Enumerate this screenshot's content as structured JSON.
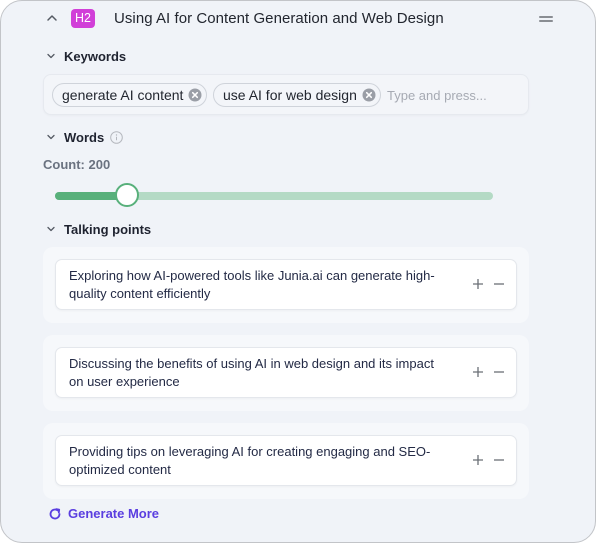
{
  "section": {
    "heading_level": "H2",
    "title": "Using AI for Content Generation and Web Design",
    "collapse_icon": "chevron-up-icon",
    "drag_icon": "drag-handle-icon"
  },
  "keywords": {
    "label": "Keywords",
    "chips": [
      {
        "text": "generate AI content"
      },
      {
        "text": "use AI for web design"
      }
    ],
    "input_value": "",
    "input_placeholder": "Type and press..."
  },
  "words": {
    "label": "Words",
    "info_icon": "info-icon",
    "count_label": "Count: 200",
    "count": 200,
    "slider_fraction": 0.165,
    "colors": {
      "fill": "#58b07b",
      "track": "#b4dac5"
    }
  },
  "talking_points": {
    "label": "Talking points",
    "items": [
      {
        "text": "Exploring how AI-powered tools like Junia.ai can generate high-quality content efficiently"
      },
      {
        "text": "Discussing the benefits of using AI in web design and its impact on user experience"
      },
      {
        "text": "Providing tips on leveraging AI for creating engaging and SEO-optimized content"
      }
    ],
    "generate_more_label": "Generate More"
  },
  "colors": {
    "heading_badge": "#d13fd8",
    "accent": "#5a3ee0",
    "panel_bg": "#f0f3f8"
  }
}
